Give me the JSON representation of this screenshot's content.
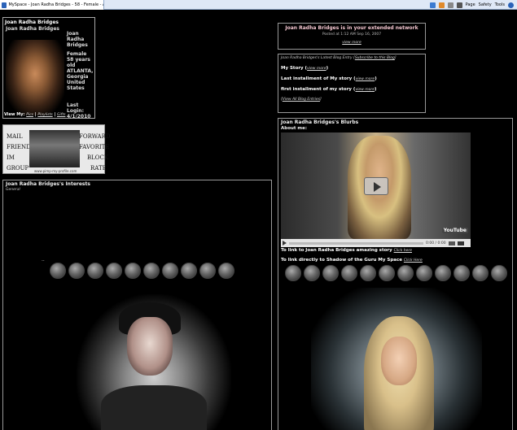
{
  "browser": {
    "tab_title": "MySpace - Joan Radha Bridges - 58 - Female - AT...",
    "toolbar": [
      "Page",
      "Safety",
      "Tools"
    ]
  },
  "profile": {
    "header": "Joan Radha Bridges",
    "name": "Joan Radha Bridges",
    "display_name": "Joan Radha Bridges",
    "gender": "Female",
    "age": "58 years old",
    "city": "ATLANTA,",
    "state": "Georgia",
    "country": "United States",
    "last_login_label": "Last Login:",
    "last_login": "4/1/2010",
    "view_my_label": "View My:",
    "view_pics": "Pics",
    "view_playlists": "Playlists",
    "view_gifts": "Gifts"
  },
  "contact": {
    "mail": "Mail",
    "friend": "Friend",
    "im": "IM",
    "group": "Group",
    "forward": "Forward",
    "favorite": "Favorite",
    "block": "Block",
    "rate": "Rate",
    "url": "www.pimp-my-profile.com"
  },
  "interests": {
    "title": "Joan Radha Bridges's Interests",
    "general": "General",
    "dots": ".."
  },
  "network": {
    "title": "Joan Radha Bridges is in your extended network",
    "posted": "Posted at 1:12 AM Sep 16, 2007",
    "view_more": "view more"
  },
  "blog": {
    "latest": "Joan Radha Bridges's Latest Blog Entry",
    "subscribe": "Subscribe to this Blog",
    "entries": [
      {
        "title": "My Story",
        "link": "view more"
      },
      {
        "title": "Last installment of My story",
        "link": "view more"
      },
      {
        "title": "first installment of my story",
        "link": "view more"
      }
    ],
    "view_all": "View All Blog Entries"
  },
  "blurbs": {
    "title": "Joan Radha Bridges's Blurbs",
    "about": "About me:",
    "video_time": "0:00 / 0:00",
    "youtube": "YouTube",
    "link1": "To link to Joan Radha Bridges amazing story",
    "link1_cta": "Click here",
    "link2": "To link directly to Shadow of the Guru My Space",
    "link2_cta": "Click Here"
  }
}
